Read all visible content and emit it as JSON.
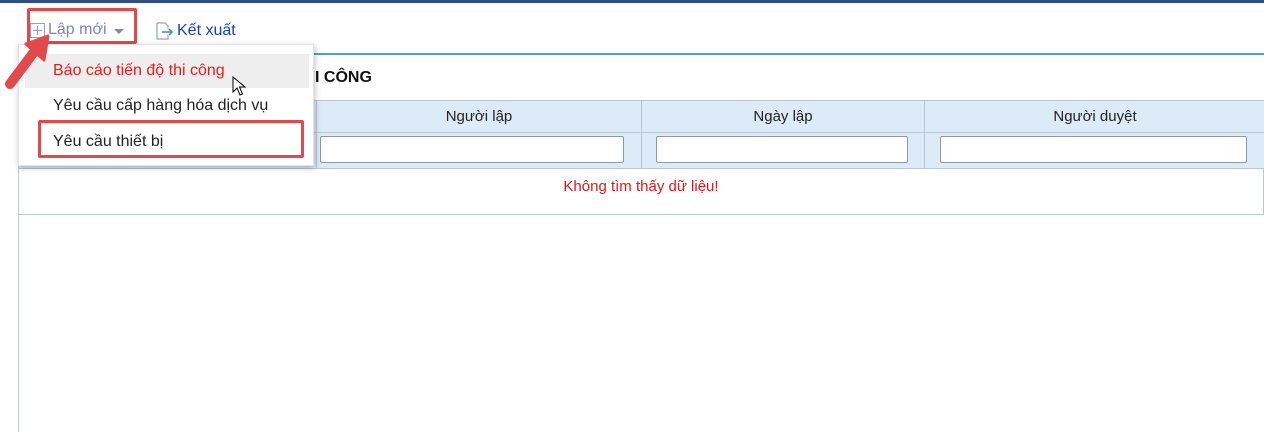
{
  "toolbar": {
    "new_label": "Lập mới",
    "export_label": "Kết xuất"
  },
  "panel": {
    "title": "I CÔNG"
  },
  "grid": {
    "columns": [
      "Người lập",
      "Ngày lập",
      "Người duyệt"
    ],
    "filters": [
      "",
      "",
      ""
    ],
    "empty_message": "Không tìm thấy dữ liệu!"
  },
  "dropdown": {
    "items": [
      "Báo cáo tiến độ thi công",
      "Yêu cầu cấp hàng hóa dịch vụ",
      "Yêu cầu thiết bị"
    ]
  },
  "colors": {
    "accent_red": "#e14a4a",
    "link_blue": "#1a3fb0",
    "header_bg": "#ddeaf7",
    "empty_text": "#e01818"
  }
}
